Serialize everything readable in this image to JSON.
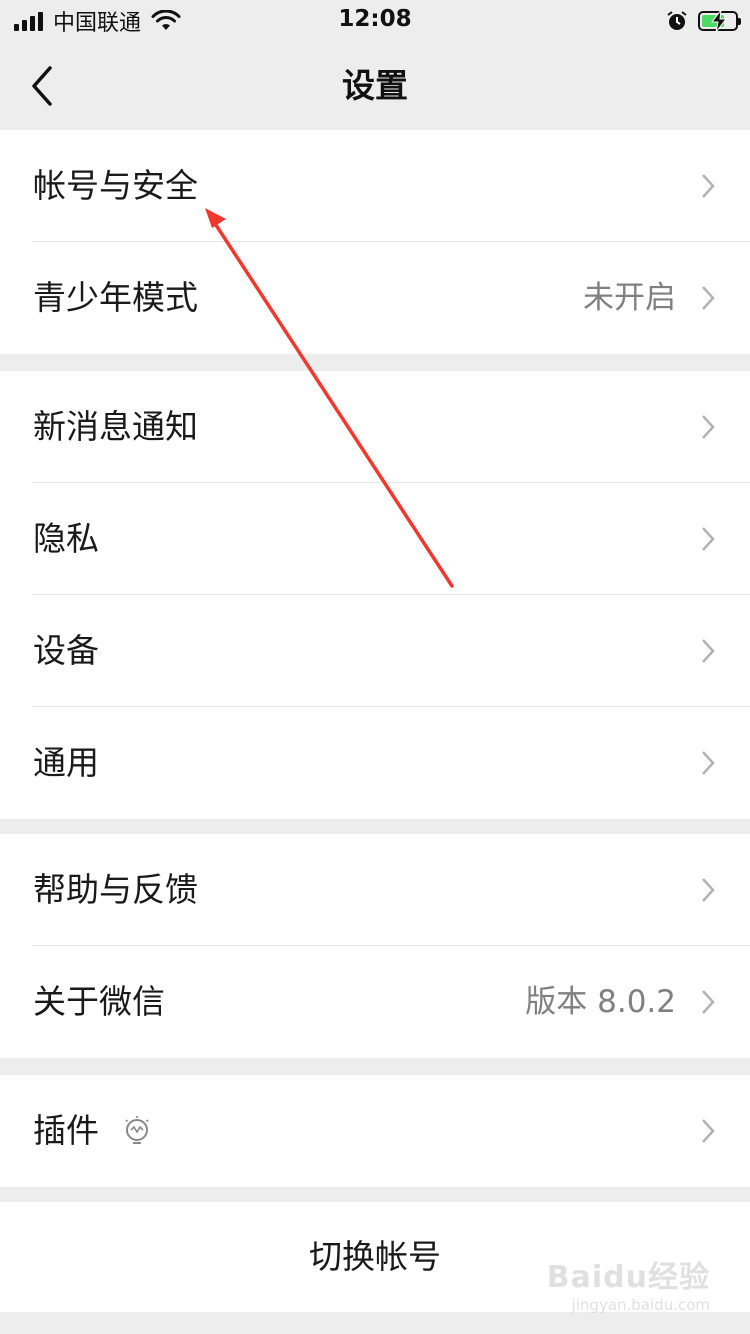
{
  "status_bar": {
    "carrier": "中国联通",
    "time": "12:08",
    "battery_color": "#4cd964"
  },
  "nav": {
    "title": "设置",
    "back_icon": "chevron-left-icon"
  },
  "groups": [
    {
      "rows": [
        {
          "label": "帐号与安全",
          "value": ""
        },
        {
          "label": "青少年模式",
          "value": "未开启"
        }
      ]
    },
    {
      "rows": [
        {
          "label": "新消息通知",
          "value": ""
        },
        {
          "label": "隐私",
          "value": ""
        },
        {
          "label": "设备",
          "value": ""
        },
        {
          "label": "通用",
          "value": ""
        }
      ]
    },
    {
      "rows": [
        {
          "label": "帮助与反馈",
          "value": ""
        },
        {
          "label": "关于微信",
          "value": "版本 8.0.2"
        }
      ]
    },
    {
      "rows": [
        {
          "label": "插件",
          "value": "",
          "icon": "lightbulb-icon"
        }
      ]
    }
  ],
  "switch_account": "切换帐号",
  "annotation": {
    "color": "#f2382e"
  },
  "watermark": {
    "logo": "Baidu经验",
    "url": "jingyan.baidu.com"
  }
}
